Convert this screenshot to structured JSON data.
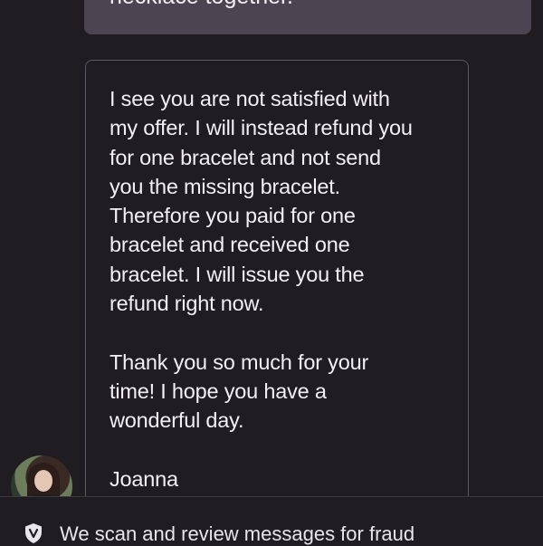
{
  "sent_message": {
    "text": "necklace together."
  },
  "received_message": {
    "paragraphs": [
      "I see you are not satisfied with\nmy offer. I will instead refund you\nfor one bracelet and not send\nyou the missing bracelet.\nTherefore you paid for one\nbracelet and received one\nbracelet. I will issue you the\nrefund right now.",
      "Thank you so much for your\ntime! I hope you have a\nwonderful day.",
      "Joanna"
    ]
  },
  "footer": {
    "notice": "We scan and review messages for fraud",
    "icon": "shield-v-icon"
  },
  "colors": {
    "background": "#1f1c22",
    "sent_bubble": "#4a4550",
    "received_border": "#5b5763",
    "text": "#f2f0f4"
  }
}
